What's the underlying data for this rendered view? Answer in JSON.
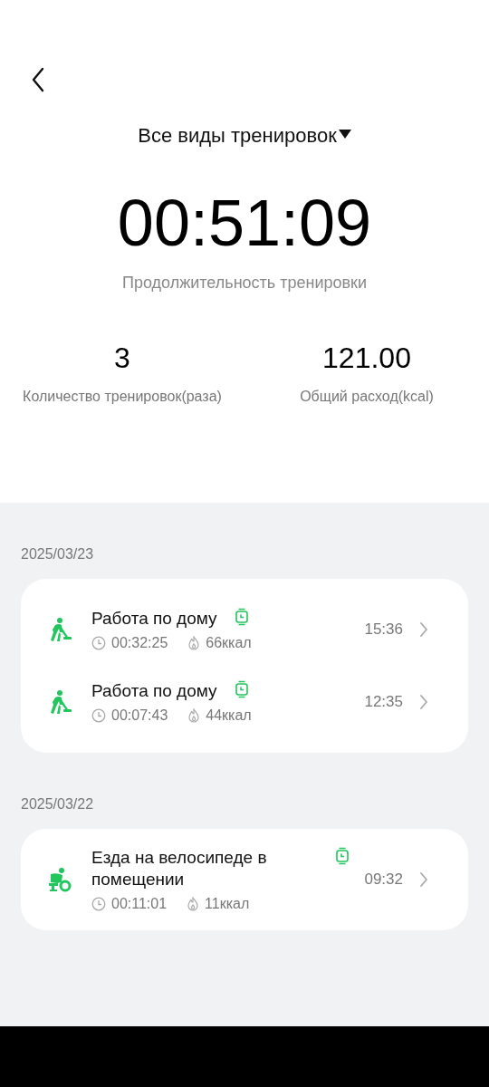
{
  "filter": {
    "label": "Все виды тренировок"
  },
  "total": {
    "value": "00:51:09",
    "label": "Продолжительность тренировки"
  },
  "stats": [
    {
      "value": "3",
      "label": "Количество тренировок(раза)"
    },
    {
      "value": "121.00",
      "label": "Общий расход(kcal)"
    }
  ],
  "days": [
    {
      "date": "2025/03/23",
      "workouts": [
        {
          "kind": "housework",
          "name": "Работа по дому",
          "duration": "00:32:25",
          "calories": "66ккал",
          "time": "15:36"
        },
        {
          "kind": "housework",
          "name": "Работа по дому",
          "duration": "00:07:43",
          "calories": "44ккал",
          "time": "12:35"
        }
      ]
    },
    {
      "date": "2025/03/22",
      "workouts": [
        {
          "kind": "cycling",
          "name": "Езда на велосипеде в помещении",
          "duration": "00:11:01",
          "calories": "11ккал",
          "time": "09:32"
        }
      ]
    }
  ]
}
